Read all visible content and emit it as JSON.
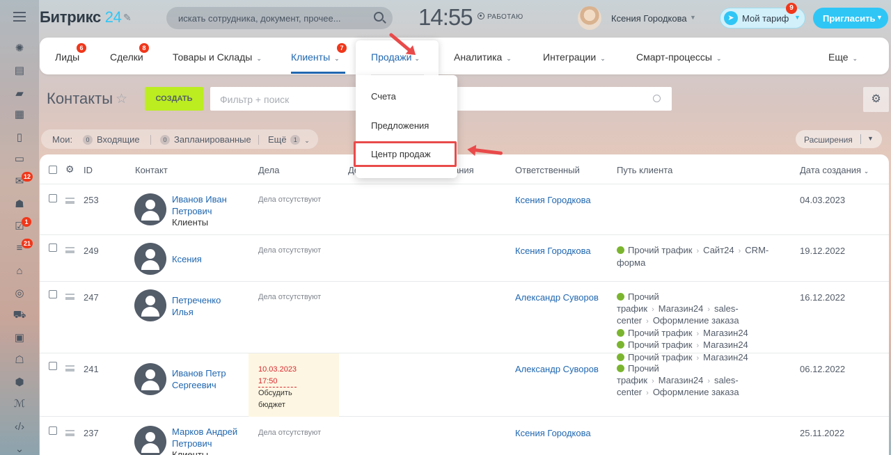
{
  "app": {
    "logo_main": "Битрикс",
    "logo_num": "24",
    "search_placeholder": "искать сотрудника, документ, прочее...",
    "clock": "14:55",
    "status": "РАБОТАЮ",
    "user_name": "Ксения Городкова",
    "tariff_label": "Мой тариф",
    "tariff_badge": "9",
    "invite_label": "Пригласить"
  },
  "sidebar": {
    "badges": {
      "mail": "12",
      "tasks": "1",
      "crm": "21"
    }
  },
  "nav": {
    "items": [
      {
        "label": "Лиды",
        "badge": "6"
      },
      {
        "label": "Сделки",
        "badge": "8"
      },
      {
        "label": "Товары и Склады"
      },
      {
        "label": "Клиенты",
        "badge": "7"
      },
      {
        "label": "Продажи"
      },
      {
        "label": "Аналитика"
      },
      {
        "label": "Интеграции"
      },
      {
        "label": "Смарт-процессы"
      },
      {
        "label": "Еще"
      }
    ]
  },
  "dropdown": {
    "title": "Продажи",
    "items": [
      "Счета",
      "Предложения",
      "Центр продаж"
    ]
  },
  "page": {
    "title": "Контакты",
    "create_label": "СОЗДАТЬ",
    "filter_placeholder": "Фильтр + поиск"
  },
  "counters": {
    "my_label": "Мои:",
    "incoming_count": "0",
    "incoming_label": "Входящие",
    "planned_count": "0",
    "planned_label": "Запланированные",
    "more_label": "Ещё",
    "more_count": "1",
    "extensions_label": "Расширения"
  },
  "grid": {
    "headers": {
      "id": "ID",
      "contact": "Контакт",
      "deals": "Дела",
      "col_hidden_a": "Де",
      "col_hidden_b": "ания",
      "responsible": "Ответственный",
      "path": "Путь клиента",
      "created": "Дата создания"
    },
    "rows": [
      {
        "id": "253",
        "name": "Иванов Иван Петрович",
        "type": "Клиенты",
        "deals": "Дела отсутствуют",
        "responsible": "Ксения Городкова",
        "path": [],
        "date": "04.03.2023"
      },
      {
        "id": "249",
        "name": "Ксения",
        "type": "",
        "deals": "Дела отсутствуют",
        "responsible": "Ксения Городкова",
        "path": [
          [
            "Прочий трафик",
            "Сайт24",
            "CRM-форма"
          ]
        ],
        "date": "19.12.2022"
      },
      {
        "id": "247",
        "name": "Петреченко Илья",
        "type": "",
        "deals": "Дела отсутствуют",
        "responsible": "Александр Суворов",
        "path": [
          [
            "Прочий трафик",
            "Магазин24",
            "sales-center",
            "Оформление заказа"
          ],
          [
            "Прочий трафик",
            "Магазин24"
          ],
          [
            "Прочий трафик",
            "Магазин24"
          ],
          [
            "Прочий трафик",
            "Магазин24"
          ]
        ],
        "date": "16.12.2022"
      },
      {
        "id": "241",
        "name": "Иванов Петр Сергеевич",
        "type": "",
        "deal_date": "10.03.2023 17:50",
        "deal_text": "Обсудить бюджет",
        "responsible": "Александр Суворов",
        "path": [
          [
            "Прочий трафик",
            "Магазин24",
            "sales-center",
            "Оформление заказа"
          ]
        ],
        "date": "06.12.2022"
      },
      {
        "id": "237",
        "name": "Марков Андрей Петрович",
        "type": "Клиенты",
        "deals": "Дела отсутствуют",
        "responsible": "Ксения Городкова",
        "path": [],
        "date": "25.11.2022"
      }
    ]
  },
  "colors": {
    "accent": "#2fc6f6",
    "link": "#2067b0",
    "create": "#bbed21",
    "badge": "#f0371b",
    "highlight": "#e94a4a"
  }
}
